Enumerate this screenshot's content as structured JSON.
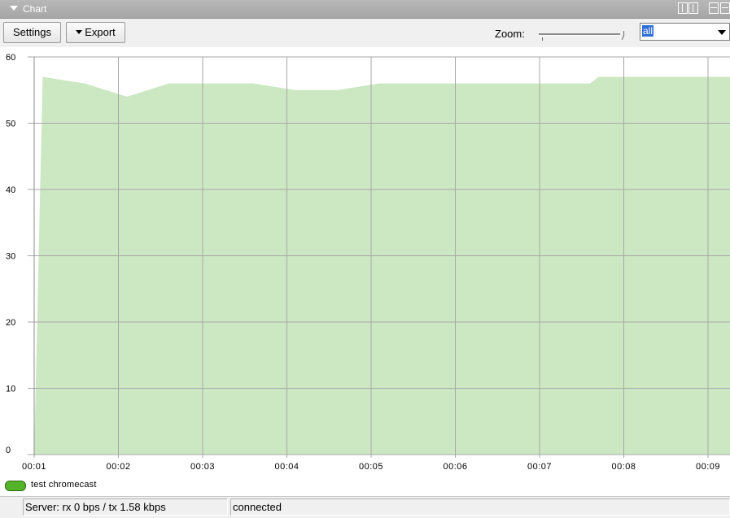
{
  "window": {
    "title": "Chart"
  },
  "toolbar": {
    "settings_label": "Settings",
    "export_label": "Export",
    "zoom_label": "Zoom:",
    "zoom_value": "all"
  },
  "legend": {
    "items": [
      {
        "label": "test chromecast",
        "color": "#55b32a"
      }
    ]
  },
  "status": {
    "server": "Server: rx 0 bps / tx 1.58 kbps",
    "connection": "connected"
  },
  "colors": {
    "area_fill": "#cce8c2",
    "grid": "#a7a7a7",
    "title_bar": "#aaaaaa"
  },
  "chart_data": {
    "type": "area",
    "title": "",
    "xlabel": "",
    "ylabel": "",
    "ylim": [
      0,
      60
    ],
    "y_ticks": [
      "0",
      "10",
      "20",
      "30",
      "40",
      "50",
      "60"
    ],
    "x_ticks": [
      "00:01",
      "00:02",
      "00:03",
      "00:04",
      "00:05",
      "00:06",
      "00:07",
      "00:08",
      "00:09"
    ],
    "grid": true,
    "legend_position": "bottom-left",
    "series": [
      {
        "name": "test chromecast",
        "color": "#cce8c2",
        "points": [
          {
            "x": "00:01.0",
            "y": 0
          },
          {
            "x": "00:01.1",
            "y": 57
          },
          {
            "x": "00:01.6",
            "y": 56
          },
          {
            "x": "00:02.1",
            "y": 54
          },
          {
            "x": "00:02.6",
            "y": 56
          },
          {
            "x": "00:03.1",
            "y": 56
          },
          {
            "x": "00:03.6",
            "y": 56
          },
          {
            "x": "00:04.1",
            "y": 55
          },
          {
            "x": "00:04.6",
            "y": 55
          },
          {
            "x": "00:05.1",
            "y": 56
          },
          {
            "x": "00:05.6",
            "y": 56
          },
          {
            "x": "00:06.1",
            "y": 56
          },
          {
            "x": "00:06.6",
            "y": 56
          },
          {
            "x": "00:07.1",
            "y": 56
          },
          {
            "x": "00:07.6",
            "y": 56
          },
          {
            "x": "00:07.7",
            "y": 57
          },
          {
            "x": "00:08.1",
            "y": 57
          },
          {
            "x": "00:08.6",
            "y": 57
          },
          {
            "x": "00:09.3",
            "y": 57
          }
        ]
      }
    ]
  }
}
